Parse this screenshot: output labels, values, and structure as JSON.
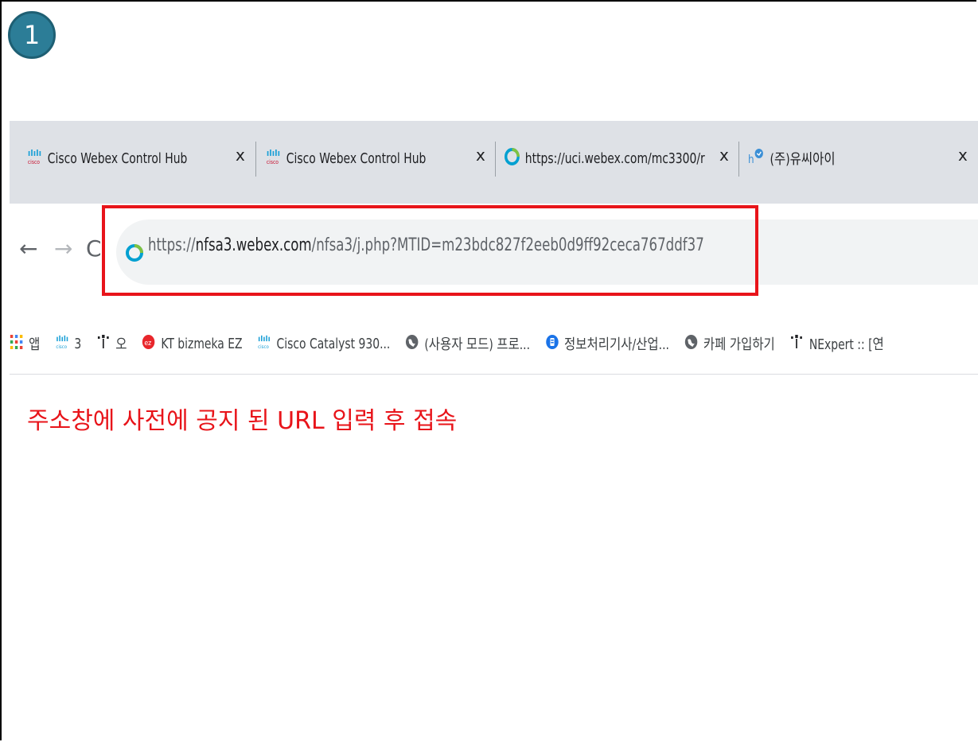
{
  "step": {
    "number": "1"
  },
  "tabs": [
    {
      "title": "Cisco Webex Control Hub",
      "close": "x",
      "favicon": "cisco-icon"
    },
    {
      "title": "Cisco Webex Control Hub",
      "close": "x",
      "favicon": "cisco-icon"
    },
    {
      "title": "https://uci.webex.com/mc3300/r",
      "close": "x",
      "favicon": "webex-icon"
    },
    {
      "title": "(주)유씨아이",
      "close": "x",
      "favicon": "hi-icon"
    }
  ],
  "toolbar": {
    "back": "←",
    "forward": "→",
    "reload": "C"
  },
  "address_bar": {
    "scheme": "https://",
    "host": "nfsa3.webex.com",
    "path": "/nfsa3/j.php?MTID=m23bdc827f2eeb0d9ff92ceca767ddf37"
  },
  "bookmarks": [
    {
      "label": "앱",
      "icon": "apps-grid-icon"
    },
    {
      "label": "3",
      "icon": "cisco-icon"
    },
    {
      "label": "오",
      "icon": "tree-icon"
    },
    {
      "label": "KT bizmeka EZ",
      "icon": "kt-icon"
    },
    {
      "label": "Cisco Catalyst 930...",
      "icon": "cisco-icon"
    },
    {
      "label": "(사용자 모드) 프로...",
      "icon": "globe-icon"
    },
    {
      "label": "정보처리기사/산업...",
      "icon": "blog-icon"
    },
    {
      "label": "카페 가입하기",
      "icon": "globe-icon"
    },
    {
      "label": "NExpert :: [연",
      "icon": "tree-icon"
    }
  ],
  "instruction": "주소창에 사전에 공지 된 URL 입력 후 접속",
  "colors": {
    "highlight": "#e8141a",
    "badge": "#2c7d97",
    "tabbar": "#dee1e6"
  }
}
